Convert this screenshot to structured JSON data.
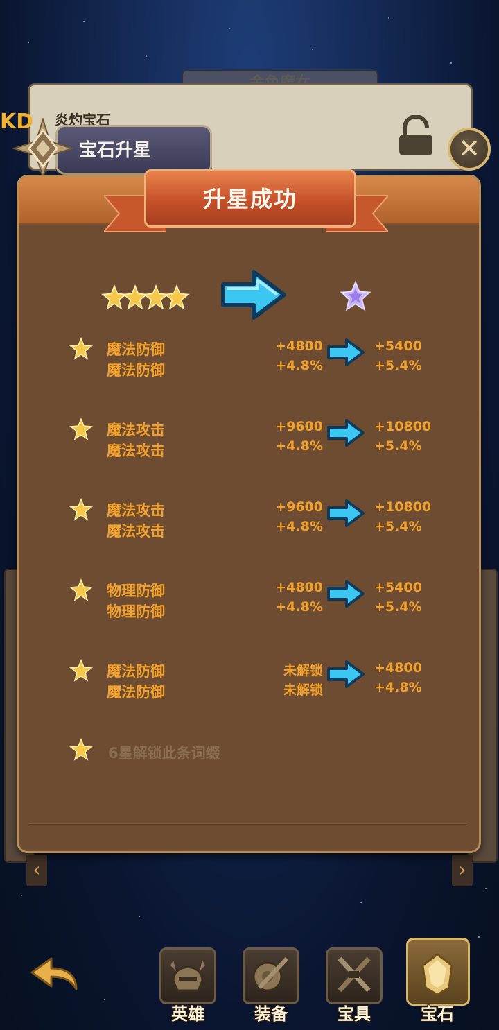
{
  "background": {
    "title_tab": "金色魔女",
    "panel_title": "炎灼宝石",
    "left_edge_text": "KD"
  },
  "header": {
    "title": "宝石升星"
  },
  "popup": {
    "banner_title": "升星成功",
    "old_stars": 4,
    "new_stars": 1,
    "attributes": [
      {
        "name1": "魔法防御",
        "name2": "魔法防御",
        "old1": "+4800",
        "old2": "+4.8%",
        "new1": "+5400",
        "new2": "+5.4%"
      },
      {
        "name1": "魔法攻击",
        "name2": "魔法攻击",
        "old1": "+9600",
        "old2": "+4.8%",
        "new1": "+10800",
        "new2": "+5.4%"
      },
      {
        "name1": "魔法攻击",
        "name2": "魔法攻击",
        "old1": "+9600",
        "old2": "+4.8%",
        "new1": "+10800",
        "new2": "+5.4%"
      },
      {
        "name1": "物理防御",
        "name2": "物理防御",
        "old1": "+4800",
        "old2": "+4.8%",
        "new1": "+5400",
        "new2": "+5.4%"
      },
      {
        "name1": "魔法防御",
        "name2": "魔法防御",
        "old1": "未解锁",
        "old2": "未解锁",
        "new1": "+4800",
        "new2": "+4.8%"
      }
    ],
    "locked_row": "6星解锁此条词缀"
  },
  "bottom_nav": {
    "tabs": [
      {
        "label": "英雄",
        "icon": "helmet-icon"
      },
      {
        "label": "装备",
        "icon": "sword-shield-icon"
      },
      {
        "label": "宝具",
        "icon": "crossed-swords-icon"
      },
      {
        "label": "宝石",
        "icon": "gem-icon",
        "active": true
      }
    ]
  },
  "colors": {
    "attr_text": "#f2a22c",
    "locked_text": "#8b6d4f",
    "panel_bg": "#6e4c31",
    "banner": "#c5512a"
  }
}
